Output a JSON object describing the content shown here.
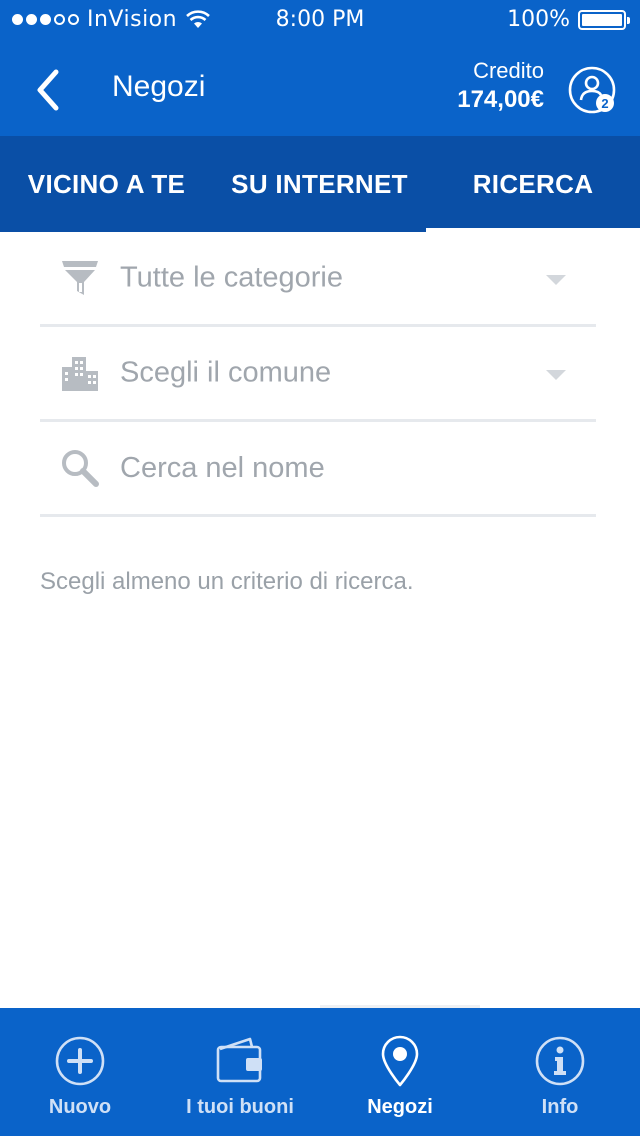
{
  "status_bar": {
    "carrier": "InVision",
    "time": "8:00 PM",
    "battery": "100%"
  },
  "header": {
    "title": "Negozi",
    "credit_label": "Credito",
    "credit_value": "174,00€",
    "account_badge": "2"
  },
  "tabs": [
    {
      "label": "VICINO A TE"
    },
    {
      "label": "SU INTERNET"
    },
    {
      "label": "RICERCA",
      "active": true
    }
  ],
  "form": {
    "category": "Tutte le categorie",
    "city": "Scegli il comune",
    "search_placeholder": "Cerca nel nome"
  },
  "hint": "Scegli almeno un criterio di ricerca.",
  "bottom_nav": [
    {
      "label": "Nuovo",
      "icon": "plus-circle-icon"
    },
    {
      "label": "I tuoi buoni",
      "icon": "wallet-icon"
    },
    {
      "label": "Negozi",
      "icon": "map-pin-icon",
      "active": true
    },
    {
      "label": "Info",
      "icon": "info-icon"
    }
  ],
  "colors": {
    "primary": "#0a63c9",
    "tabs_bg": "#0a4fa6",
    "placeholder": "#a0a6ad",
    "icon_gray": "#b7bcc2"
  }
}
